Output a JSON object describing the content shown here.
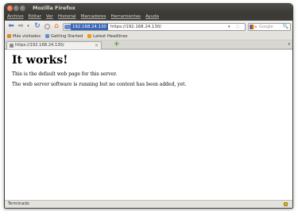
{
  "window": {
    "title": "Mozilla Firefox"
  },
  "menubar": {
    "items": [
      "Archivo",
      "Editar",
      "Ver",
      "Historial",
      "Marcadores",
      "Herramientas",
      "Ayuda"
    ]
  },
  "navbar": {
    "back_glyph": "⬅",
    "forward_glyph": "➡",
    "dropdown_glyph": "▾",
    "reload_glyph": "↻",
    "home_glyph": "⌂",
    "url_selected": "192.168.24.130",
    "url_rest": "https://192.168.24.130/",
    "url_dropdown_glyph": "▾",
    "star_glyph": "☆",
    "search_placeholder": "Google",
    "search_glyph": "🔍"
  },
  "bookmarks": {
    "items": [
      "Más visitados",
      "Getting Started",
      "Latest Headlines"
    ]
  },
  "tabs": {
    "active_label": "https://192.168.24.130/",
    "close_glyph": "×",
    "new_tab_glyph": "+",
    "list_glyph": "▾"
  },
  "page": {
    "heading": "It works!",
    "paragraphs": [
      "This is the default web page for this server.",
      "The web server software is running but no content has been added, yet."
    ]
  },
  "statusbar": {
    "text": "Terminado"
  },
  "colors": {
    "titlebar": "#3c3b37",
    "url_selection": "#3a68b6",
    "chrome_bg": "#e4e2dd"
  }
}
